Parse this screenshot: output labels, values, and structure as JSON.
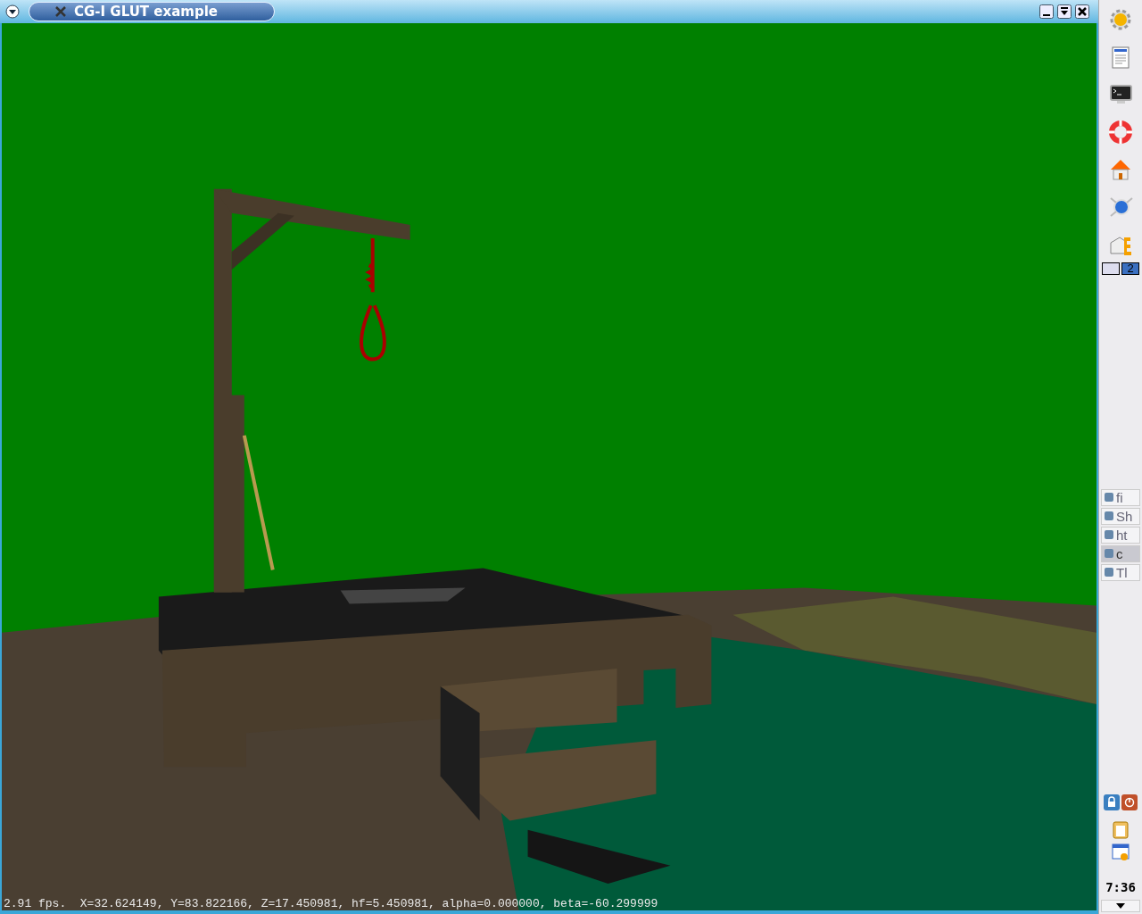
{
  "window": {
    "title": "CG-I GLUT example",
    "status_text": "2.91 fps.  X=32.624149, Y=83.822166, Z=17.450981, hf=5.450981, alpha=0.000000, beta=-60.299999"
  },
  "panel": {
    "pager": [
      {
        "selected": false
      },
      {
        "label": "2",
        "selected": true
      }
    ],
    "tasks": [
      {
        "label": "fi",
        "selected": false
      },
      {
        "label": "Sh",
        "selected": false
      },
      {
        "label": "ht",
        "selected": false
      },
      {
        "label": "c",
        "selected": true
      },
      {
        "label": "Tl",
        "selected": false
      }
    ],
    "clock": "7:36"
  }
}
